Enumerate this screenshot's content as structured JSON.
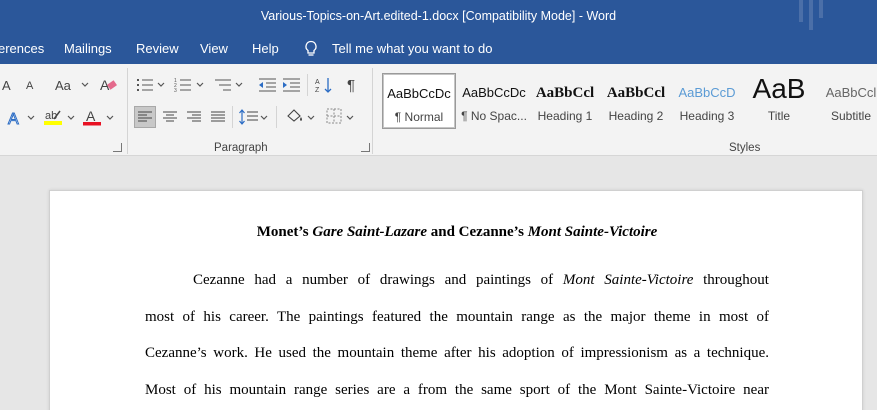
{
  "window": {
    "title": "Various-Topics-on-Art.edited-1.docx [Compatibility Mode]  -  Word"
  },
  "menu": {
    "items": [
      "erences",
      "Mailings",
      "Review",
      "View",
      "Help"
    ],
    "tell_me": "Tell me what you want to do"
  },
  "ribbon": {
    "paragraph_label": "Paragraph",
    "styles_label": "Styles",
    "font_size_up": "A",
    "font_size_down": "A",
    "change_case": "Aa",
    "pilcrow": "¶",
    "styles": [
      {
        "sample": "AaBbCcDc",
        "name": "¶ Normal",
        "selected": true
      },
      {
        "sample": "AaBbCcDc",
        "name": "¶ No Spac..."
      },
      {
        "sample": "AaBbCcl",
        "name": "Heading 1"
      },
      {
        "sample": "AaBbCcl",
        "name": "Heading 2"
      },
      {
        "sample": "AaBbCcD",
        "name": "Heading 3"
      },
      {
        "sample": "AaB",
        "name": "Title"
      },
      {
        "sample": "AaBbCcl",
        "name": "Subtitle"
      }
    ],
    "colors": {
      "highlight": "#ffff00",
      "font_color": "#e81123",
      "accent": "#2b579a"
    }
  },
  "document": {
    "title_parts": [
      {
        "text": "Monet’s ",
        "italic": false
      },
      {
        "text": "Gare Saint-Lazare",
        "italic": true
      },
      {
        "text": " and Cezanne’s ",
        "italic": false
      },
      {
        "text": "Mont Sainte-Victoire",
        "italic": true
      }
    ],
    "lines": [
      {
        "first": true,
        "parts": [
          {
            "text": "Cezanne had a number of drawings and paintings of ",
            "italic": false
          },
          {
            "text": "Mont Sainte-Victoire",
            "italic": true
          },
          {
            "text": " throughout",
            "italic": false
          }
        ]
      },
      {
        "parts": [
          {
            "text": "most of his career. The paintings featured the mountain range as the major theme in most of",
            "italic": false
          }
        ]
      },
      {
        "parts": [
          {
            "text": "Cezanne’s work. He used the mountain theme after his adoption of impressionism as a technique.",
            "italic": false
          }
        ]
      },
      {
        "parts": [
          {
            "text": "Most of his mountain range series are a from the same sport of the Mont Sainte-Victoire near",
            "italic": false
          }
        ]
      }
    ]
  }
}
